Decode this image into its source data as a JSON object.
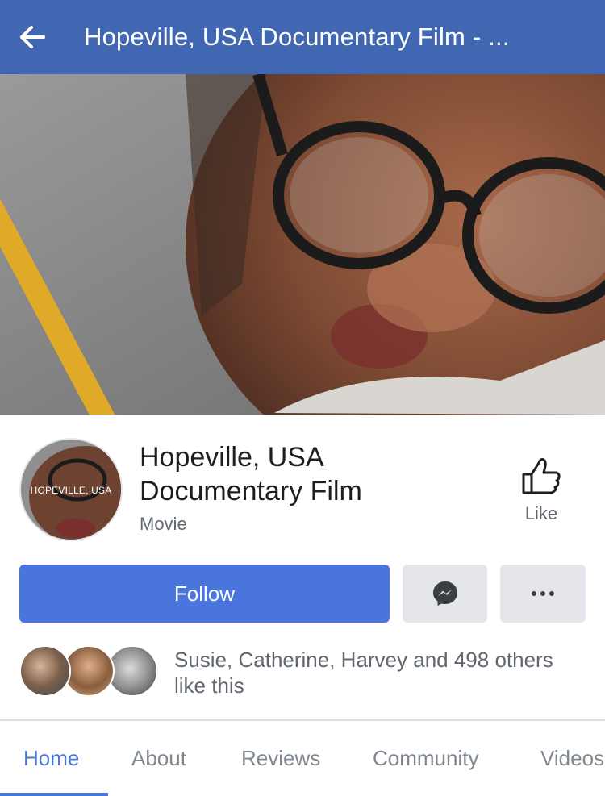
{
  "header": {
    "title": "Hopeville, USA Documentary Film - ...",
    "back_icon": "arrow-left-icon",
    "background": "#4267b2"
  },
  "profile": {
    "picture_text": "HOPEVILLE, USA",
    "name": "Hopeville, USA Documentary Film",
    "category": "Movie"
  },
  "like": {
    "label": "Like",
    "icon": "thumbs-up-icon"
  },
  "actions": {
    "follow_label": "Follow",
    "messenger_icon": "messenger-icon",
    "more_icon": "more-dots-icon",
    "accent": "#4a75dc"
  },
  "social": {
    "friends_text": "Susie, Catherine, Harvey and 498 others like this"
  },
  "tabs": [
    {
      "label": "Home",
      "active": true
    },
    {
      "label": "About",
      "active": false
    },
    {
      "label": "Reviews",
      "active": false
    },
    {
      "label": "Community",
      "active": false
    },
    {
      "label": "Videos",
      "active": false
    }
  ]
}
